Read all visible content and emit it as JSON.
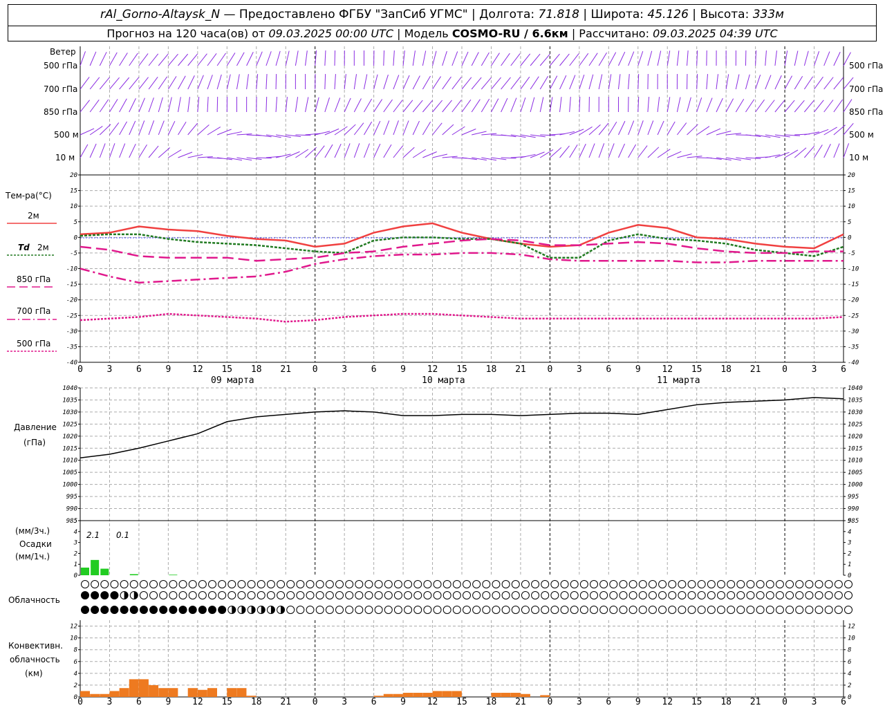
{
  "header": {
    "station": "rAl_Gorno-Altaysk_N",
    "provider": "Предоставлено ФГБУ \"ЗапСиб УГМС\"",
    "lon_label": "Долгота:",
    "lon": "71.818",
    "lat_label": "Широта:",
    "lat": "45.126",
    "alt_label": "Высота:",
    "alt": "333м",
    "forecast_label": "Прогноз на 120 часа(ов) от",
    "forecast_from": "09.03.2025 00:00 UTC",
    "model_label": "Модель",
    "model": "COSMO-RU / 6.6км",
    "calc_label": "Рассчитано:",
    "calc_time": "09.03.2025 04:39 UTC"
  },
  "labels": {
    "wind": "Ветер",
    "levels": [
      "500 гПа",
      "700 гПа",
      "850 гПа",
      "500 м",
      "10  м"
    ],
    "temp": "Тем-ра(°С)",
    "t2m": "2м",
    "td": "Td",
    "td2": "2м",
    "t850": "850 гПа",
    "t700": "700 гПа",
    "t500": "500 гПа",
    "pressure": "Давление",
    "pressure_unit": "(гПа)",
    "precip_unit1": "(мм/3ч.)",
    "precip": "Осадки",
    "precip_unit2": "(мм/1ч.)",
    "cloud": "Облачность",
    "conv1": "Конвективн.",
    "conv2": "облачность",
    "conv3": "(км)",
    "precip_total1": "2.1",
    "precip_total2": "0.1"
  },
  "colors": {
    "t2m": "#f04040",
    "td": "#207a20",
    "t850": "#e0188c",
    "t700": "#e0188c",
    "t500": "#e0188c",
    "wind": "#8a2be2",
    "pressure": "#000000",
    "precip": "#22cc22",
    "conv": "#ee7a20"
  },
  "x_axis": {
    "hour_ticks": [
      "0",
      "3",
      "6",
      "9",
      "12",
      "15",
      "18",
      "21",
      "0",
      "3",
      "6",
      "9",
      "12",
      "15",
      "18",
      "21",
      "0",
      "3",
      "6",
      "9",
      "12",
      "15",
      "18",
      "21",
      "0",
      "3",
      "6"
    ],
    "dates": [
      "09 марта",
      "10 марта",
      "11 марта"
    ]
  },
  "chart_data": [
    {
      "type": "line",
      "title": "Тем-ра(°С)",
      "x_hours": [
        0,
        3,
        6,
        9,
        12,
        15,
        18,
        21,
        24,
        27,
        30,
        33,
        36,
        39,
        42,
        45,
        48,
        51,
        54,
        57,
        60,
        63,
        66,
        69,
        72,
        75,
        78
      ],
      "ylim": [
        -40,
        20
      ],
      "yticks": [
        20,
        15,
        10,
        5,
        0,
        -5,
        -10,
        -15,
        -20,
        -25,
        -30,
        -35,
        -40
      ],
      "series": [
        {
          "name": "2м",
          "values": [
            1,
            1.5,
            3.5,
            2.5,
            2,
            0.5,
            -0.5,
            -1,
            -3,
            -2,
            1.5,
            3.5,
            4.5,
            1.5,
            -0.5,
            -2,
            -3,
            -2.5,
            1.5,
            4,
            3,
            0,
            -0.5,
            -2,
            -3,
            -3.5,
            1
          ]
        },
        {
          "name": "Td 2м",
          "values": [
            0.5,
            1,
            1,
            -0.5,
            -1.5,
            -2,
            -2.5,
            -3.5,
            -4.5,
            -5,
            -1,
            0,
            0,
            -0.5,
            -0.5,
            -2,
            -6.5,
            -6.5,
            -1,
            1,
            -0.5,
            -1,
            -2,
            -4,
            -5,
            -6,
            -3
          ]
        },
        {
          "name": "850 гПа",
          "values": [
            -3,
            -4,
            -6,
            -6.5,
            -6.5,
            -6.5,
            -7.5,
            -7,
            -6.5,
            -5,
            -4.5,
            -3,
            -2,
            -1,
            -0.5,
            -1,
            -2.5,
            -2.5,
            -2,
            -1.5,
            -2,
            -3.5,
            -4.5,
            -5,
            -5,
            -4.5,
            -4.5
          ]
        },
        {
          "name": "700 гПа",
          "values": [
            -10,
            -12.5,
            -14.5,
            -14,
            -13.5,
            -13,
            -12.5,
            -11,
            -8.5,
            -7,
            -6,
            -5.5,
            -5.5,
            -5,
            -5,
            -5.5,
            -7,
            -7.5,
            -7.5,
            -7.5,
            -7.5,
            -8,
            -8,
            -7.5,
            -7.5,
            -7.5,
            -7.5
          ]
        },
        {
          "name": "500 гПа",
          "values": [
            -26.5,
            -26,
            -25.5,
            -24.5,
            -25,
            -25.5,
            -26,
            -27,
            -26.5,
            -25.5,
            -25,
            -24.5,
            -24.5,
            -25,
            -25.5,
            -26,
            -26,
            -26,
            -26,
            -26,
            -26,
            -26,
            -26,
            -26,
            -26,
            -26,
            -25.5
          ]
        }
      ]
    },
    {
      "type": "line",
      "title": "Давление",
      "ylabel": "(гПа)",
      "x_hours": [
        0,
        3,
        6,
        9,
        12,
        15,
        18,
        21,
        24,
        27,
        30,
        33,
        36,
        39,
        42,
        45,
        48,
        51,
        54,
        57,
        60,
        63,
        66,
        69,
        72,
        75,
        78
      ],
      "ylim": [
        985,
        1040
      ],
      "yticks": [
        1040,
        1035,
        1030,
        1025,
        1020,
        1015,
        1010,
        1005,
        1000,
        995,
        990,
        985
      ],
      "values": [
        1011,
        1012.5,
        1015,
        1018,
        1021,
        1026,
        1028,
        1029,
        1030,
        1030.5,
        1030,
        1028.5,
        1028.5,
        1029,
        1029,
        1028.5,
        1029,
        1029.5,
        1029.5,
        1029,
        1031,
        1033,
        1034,
        1034.5,
        1035,
        1036,
        1035.5
      ]
    },
    {
      "type": "bar",
      "title": "Осадки",
      "ylim": [
        0,
        5
      ],
      "yticks": [
        5,
        4,
        3,
        2,
        1,
        0
      ],
      "x_hours": [
        0,
        1,
        2,
        3,
        4,
        5,
        6,
        9
      ],
      "values": [
        0.7,
        1.4,
        0.6,
        0,
        0,
        0.1,
        0,
        0.05
      ]
    },
    {
      "type": "bar",
      "title": "Конвективн. облачность",
      "ylabel": "(км)",
      "ylim": [
        0,
        13
      ],
      "yticks": [
        12,
        10,
        8,
        6,
        4,
        2,
        0
      ],
      "x_hours": [
        0,
        1,
        2,
        3,
        4,
        5,
        6,
        7,
        8,
        9,
        10,
        11,
        12,
        13,
        14,
        15,
        16,
        17,
        30,
        31,
        32,
        33,
        34,
        35,
        36,
        37,
        38,
        42,
        43,
        44,
        45,
        46,
        47
      ],
      "values": [
        1,
        0.5,
        0.5,
        1,
        1.5,
        3,
        3,
        2,
        1.5,
        1.5,
        0,
        1.5,
        1.2,
        1.5,
        0,
        1.5,
        1.5,
        0.2,
        0.2,
        0.5,
        0.5,
        0.7,
        0.7,
        0.7,
        1,
        1,
        1,
        0.7,
        0.7,
        0.7,
        0.5,
        0,
        0.3
      ]
    }
  ]
}
